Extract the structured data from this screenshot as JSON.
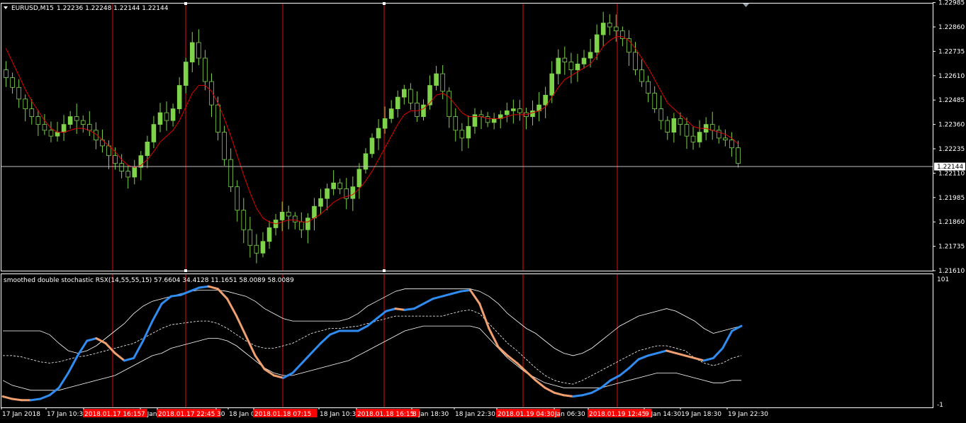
{
  "window": {
    "symbol_header": "EURUSD,M15",
    "ohlc": "1.22236 1.22248 1.22144 1.22144",
    "menu_icon": "triangle-down-icon",
    "scroll_marker_icon": "triangle-down-icon"
  },
  "colors": {
    "background": "#000000",
    "frame": "#ffffff",
    "bull_candle": "#7fd34a",
    "ma_line": "#e00000",
    "vertical_marker": "#e01010",
    "price_line": "#c0c0c0",
    "rsx_up": "#2f8cf0",
    "rsx_down": "#f0a070",
    "band": "#ffffff",
    "time_highlight_bg": "#ff0000"
  },
  "chart_data": [
    {
      "type": "candlestick",
      "title": "EURUSD,M15",
      "ylim": [
        1.2161,
        1.2298
      ],
      "y_ticks": [
        "1.22985",
        "1.22860",
        "1.22735",
        "1.22610",
        "1.22485",
        "1.22360",
        "1.22235",
        "1.22110",
        "1.21985",
        "1.21860",
        "1.21735",
        "1.21610"
      ],
      "current_price_label": "1.22144",
      "close_series": [
        1.226,
        1.2255,
        1.2249,
        1.2244,
        1.224,
        1.2236,
        1.2233,
        1.223,
        1.2232,
        1.2236,
        1.224,
        1.2238,
        1.2236,
        1.2233,
        1.2228,
        1.2225,
        1.222,
        1.2216,
        1.2212,
        1.2209,
        1.2214,
        1.222,
        1.2227,
        1.2236,
        1.2242,
        1.2238,
        1.2244,
        1.2256,
        1.2268,
        1.2278,
        1.227,
        1.2258,
        1.2246,
        1.2232,
        1.2218,
        1.2204,
        1.2192,
        1.2182,
        1.2174,
        1.217,
        1.2176,
        1.2183,
        1.2187,
        1.2191,
        1.2189,
        1.2186,
        1.2182,
        1.2188,
        1.2194,
        1.2198,
        1.2203,
        1.2206,
        1.2203,
        1.2198,
        1.2204,
        1.2213,
        1.2221,
        1.2229,
        1.2234,
        1.2239,
        1.2244,
        1.225,
        1.2254,
        1.2247,
        1.224,
        1.2246,
        1.2256,
        1.2262,
        1.2253,
        1.224,
        1.2233,
        1.2229,
        1.2235,
        1.2241,
        1.224,
        1.2237,
        1.2239,
        1.2241,
        1.2243,
        1.2244,
        1.2242,
        1.224,
        1.2243,
        1.2246,
        1.2251,
        1.2262,
        1.227,
        1.2268,
        1.2264,
        1.2267,
        1.227,
        1.2273,
        1.2282,
        1.2288,
        1.2286,
        1.2284,
        1.228,
        1.2273,
        1.2264,
        1.2258,
        1.2252,
        1.2244,
        1.2238,
        1.2232,
        1.2239,
        1.2236,
        1.223,
        1.2227,
        1.2232,
        1.2236,
        1.2233,
        1.2229,
        1.2228,
        1.2224,
        1.2216
      ],
      "ma_series": [
        1.2275,
        1.2268,
        1.2261,
        1.2254,
        1.2248,
        1.2243,
        1.2238,
        1.2234,
        1.2232,
        1.2232,
        1.2233,
        1.2234,
        1.2234,
        1.2233,
        1.2231,
        1.2228,
        1.2225,
        1.2222,
        1.2218,
        1.2215,
        1.2214,
        1.2215,
        1.2218,
        1.2222,
        1.2227,
        1.223,
        1.2233,
        1.2238,
        1.2245,
        1.2252,
        1.2256,
        1.2256,
        1.2253,
        1.2247,
        1.2239,
        1.223,
        1.222,
        1.221,
        1.2201,
        1.2193,
        1.2188,
        1.2186,
        1.2185,
        1.2186,
        1.2187,
        1.2187,
        1.2186,
        1.2186,
        1.2188,
        1.219,
        1.2193,
        1.2196,
        1.2198,
        1.2199,
        1.22,
        1.2203,
        1.2207,
        1.2212,
        1.2218,
        1.2224,
        1.223,
        1.2236,
        1.2241,
        1.2243,
        1.2243,
        1.2244,
        1.2247,
        1.2251,
        1.2252,
        1.225,
        1.2246,
        1.2242,
        1.224,
        1.224,
        1.224,
        1.2239,
        1.2239,
        1.2239,
        1.224,
        1.2241,
        1.2241,
        1.2241,
        1.2242,
        1.2243,
        1.2245,
        1.225,
        1.2255,
        1.2259,
        1.2261,
        1.2263,
        1.2265,
        1.2267,
        1.2271,
        1.2276,
        1.2279,
        1.2281,
        1.2281,
        1.2279,
        1.2275,
        1.227,
        1.2265,
        1.2259,
        1.2253,
        1.2247,
        1.2244,
        1.2241,
        1.2238,
        1.2235,
        1.2234,
        1.2234,
        1.2233,
        1.2232,
        1.2231,
        1.2229,
        1.2226
      ]
    },
    {
      "type": "line",
      "title": "smoothed double stochastic RSX(14,55,55,15) 57.6604 34.4128 11.1651 58.0089 58.0089",
      "ylim": [
        -1,
        101
      ],
      "y_ticks": [
        "101",
        "-1"
      ],
      "x_count": 80,
      "rsx_series": [
        5,
        3,
        2,
        2,
        3,
        6,
        12,
        24,
        38,
        50,
        52,
        48,
        40,
        34,
        36,
        50,
        66,
        80,
        86,
        87,
        90,
        93,
        94,
        92,
        84,
        70,
        54,
        38,
        27,
        22,
        20,
        24,
        32,
        40,
        48,
        55,
        58,
        58,
        58,
        62,
        68,
        74,
        76,
        75,
        76,
        80,
        84,
        86,
        88,
        90,
        91,
        80,
        60,
        45,
        38,
        32,
        25,
        18,
        12,
        8,
        6,
        5,
        6,
        8,
        12,
        18,
        22,
        28,
        35,
        38,
        40,
        42,
        40,
        38,
        36,
        34,
        36,
        44,
        58,
        62
      ],
      "rsx_trend": [
        "dn",
        "dn",
        "dn",
        "dn",
        "up",
        "up",
        "up",
        "up",
        "up",
        "up",
        "up",
        "dn",
        "dn",
        "dn",
        "up",
        "up",
        "up",
        "up",
        "up",
        "up",
        "up",
        "up",
        "up",
        "dn",
        "dn",
        "dn",
        "dn",
        "dn",
        "dn",
        "dn",
        "dn",
        "up",
        "up",
        "up",
        "up",
        "up",
        "up",
        "up",
        "up",
        "up",
        "up",
        "up",
        "up",
        "dn",
        "up",
        "up",
        "up",
        "up",
        "up",
        "up",
        "up",
        "dn",
        "dn",
        "dn",
        "dn",
        "dn",
        "dn",
        "dn",
        "dn",
        "dn",
        "dn",
        "dn",
        "up",
        "up",
        "up",
        "up",
        "up",
        "up",
        "up",
        "up",
        "up",
        "up",
        "dn",
        "dn",
        "dn",
        "dn",
        "up",
        "up",
        "up",
        "up"
      ],
      "signal_series": [
        38,
        38,
        37,
        35,
        33,
        32,
        33,
        35,
        37,
        38,
        40,
        42,
        44,
        46,
        48,
        52,
        56,
        60,
        63,
        64,
        65,
        66,
        66,
        64,
        60,
        55,
        50,
        46,
        44,
        44,
        46,
        48,
        52,
        56,
        58,
        60,
        60,
        61,
        62,
        64,
        66,
        68,
        70,
        70,
        70,
        70,
        70,
        70,
        72,
        74,
        75,
        72,
        64,
        56,
        48,
        42,
        35,
        28,
        22,
        18,
        16,
        15,
        18,
        22,
        26,
        30,
        34,
        38,
        42,
        44,
        46,
        46,
        44,
        42,
        36,
        32,
        30,
        32,
        36,
        38
      ],
      "upper_band": [
        58,
        58,
        58,
        58,
        58,
        55,
        48,
        42,
        40,
        42,
        46,
        52,
        58,
        64,
        72,
        78,
        82,
        84,
        86,
        88,
        90,
        91,
        91,
        91,
        90,
        88,
        86,
        82,
        76,
        72,
        68,
        66,
        66,
        66,
        66,
        66,
        66,
        68,
        72,
        78,
        82,
        86,
        90,
        92,
        92,
        92,
        92,
        92,
        92,
        92,
        92,
        90,
        86,
        80,
        72,
        66,
        60,
        56,
        50,
        44,
        40,
        38,
        40,
        44,
        50,
        56,
        62,
        66,
        70,
        72,
        74,
        76,
        74,
        70,
        66,
        60,
        56,
        58,
        60,
        62
      ],
      "lower_band": [
        18,
        14,
        12,
        10,
        10,
        10,
        10,
        12,
        14,
        16,
        18,
        20,
        22,
        26,
        30,
        34,
        38,
        40,
        44,
        46,
        48,
        50,
        52,
        52,
        50,
        46,
        40,
        34,
        28,
        24,
        22,
        22,
        24,
        26,
        28,
        30,
        32,
        34,
        38,
        42,
        46,
        50,
        54,
        58,
        60,
        62,
        62,
        62,
        62,
        62,
        62,
        60,
        52,
        44,
        36,
        30,
        24,
        20,
        16,
        14,
        12,
        12,
        12,
        12,
        12,
        14,
        16,
        18,
        20,
        22,
        24,
        24,
        24,
        22,
        20,
        18,
        16,
        16,
        18,
        18
      ]
    }
  ],
  "time_axis": {
    "labels": [
      {
        "text": "17 Jan 2018",
        "highlight": false
      },
      {
        "text": "17 Jan 10:30",
        "highlight": false
      },
      {
        "text": "2018.01.17 16:15",
        "highlight": true
      },
      {
        "text": "7 Jan",
        "highlight": false
      },
      {
        "text": "2018.01.17 22:45",
        "highlight": true
      },
      {
        "text": "30",
        "highlight": false
      },
      {
        "text": "18 Jan 0",
        "highlight": false
      },
      {
        "text": "2018.01.18 07:15",
        "highlight": true
      },
      {
        "text": "18 Jan 10:30",
        "highlight": false
      },
      {
        "text": "2018.01.18 16:15",
        "highlight": true
      },
      {
        "text": "8 Jan 18:30",
        "highlight": false
      },
      {
        "text": "18 Jan 22:30",
        "highlight": false
      },
      {
        "text": "2018.01.19 04:30",
        "highlight": true
      },
      {
        "text": "Jan 06:30",
        "highlight": false
      },
      {
        "text": "2018.01.19 12:45",
        "highlight": true
      },
      {
        "text": "9 Jan 14:30",
        "highlight": false
      },
      {
        "text": "19 Jan 18:30",
        "highlight": false
      },
      {
        "text": "19 Jan 22:30",
        "highlight": false
      }
    ]
  }
}
